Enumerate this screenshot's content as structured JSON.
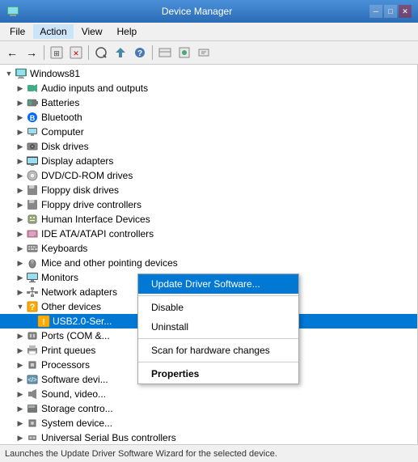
{
  "titlebar": {
    "title": "Device Manager"
  },
  "menu": {
    "items": [
      "File",
      "Action",
      "View",
      "Help"
    ]
  },
  "toolbar": {
    "buttons": [
      "←",
      "→",
      "⊞",
      "⊟",
      "📋",
      "🔄",
      "❌",
      "⚡",
      "🔍"
    ]
  },
  "tree": {
    "root": "Windows81",
    "items": [
      {
        "id": "root",
        "label": "Windows81",
        "level": 1,
        "expand": "expanded",
        "icon": "💻"
      },
      {
        "id": "audio",
        "label": "Audio inputs and outputs",
        "level": 2,
        "expand": "collapsed",
        "icon": "🔊"
      },
      {
        "id": "batteries",
        "label": "Batteries",
        "level": 2,
        "expand": "collapsed",
        "icon": "🔋"
      },
      {
        "id": "bluetooth",
        "label": "Bluetooth",
        "level": 2,
        "expand": "collapsed",
        "icon": "🔵"
      },
      {
        "id": "computer",
        "label": "Computer",
        "level": 2,
        "expand": "collapsed",
        "icon": "💻"
      },
      {
        "id": "diskdrives",
        "label": "Disk drives",
        "level": 2,
        "expand": "collapsed",
        "icon": "💾"
      },
      {
        "id": "display",
        "label": "Display adapters",
        "level": 2,
        "expand": "collapsed",
        "icon": "🖥"
      },
      {
        "id": "dvd",
        "label": "DVD/CD-ROM drives",
        "level": 2,
        "expand": "collapsed",
        "icon": "💿"
      },
      {
        "id": "floppy",
        "label": "Floppy disk drives",
        "level": 2,
        "expand": "collapsed",
        "icon": "💾"
      },
      {
        "id": "floppyctrl",
        "label": "Floppy drive controllers",
        "level": 2,
        "expand": "collapsed",
        "icon": "💾"
      },
      {
        "id": "hid",
        "label": "Human Interface Devices",
        "level": 2,
        "expand": "collapsed",
        "icon": "🎮"
      },
      {
        "id": "ide",
        "label": "IDE ATA/ATAPI controllers",
        "level": 2,
        "expand": "collapsed",
        "icon": "⚙"
      },
      {
        "id": "keyboards",
        "label": "Keyboards",
        "level": 2,
        "expand": "collapsed",
        "icon": "⌨"
      },
      {
        "id": "mice",
        "label": "Mice and other pointing devices",
        "level": 2,
        "expand": "collapsed",
        "icon": "🖱"
      },
      {
        "id": "monitors",
        "label": "Monitors",
        "level": 2,
        "expand": "collapsed",
        "icon": "🖥"
      },
      {
        "id": "network",
        "label": "Network adapters",
        "level": 2,
        "expand": "collapsed",
        "icon": "🌐"
      },
      {
        "id": "other",
        "label": "Other devices",
        "level": 2,
        "expand": "expanded",
        "icon": "❓"
      },
      {
        "id": "usb2",
        "label": "USB2.0-Ser...",
        "level": 3,
        "expand": "none",
        "icon": "⚠",
        "selected": true
      },
      {
        "id": "ports",
        "label": "Ports (COM &...",
        "level": 2,
        "expand": "collapsed",
        "icon": "🔌"
      },
      {
        "id": "printq",
        "label": "Print queues",
        "level": 2,
        "expand": "collapsed",
        "icon": "🖨"
      },
      {
        "id": "proc",
        "label": "Processors",
        "level": 2,
        "expand": "collapsed",
        "icon": "⚙"
      },
      {
        "id": "softdev",
        "label": "Software devi...",
        "level": 2,
        "expand": "collapsed",
        "icon": "📦"
      },
      {
        "id": "sound",
        "label": "Sound, video...",
        "level": 2,
        "expand": "collapsed",
        "icon": "🔊"
      },
      {
        "id": "storage",
        "label": "Storage contro...",
        "level": 2,
        "expand": "collapsed",
        "icon": "💾"
      },
      {
        "id": "system",
        "label": "System device...",
        "level": 2,
        "expand": "collapsed",
        "icon": "⚙"
      },
      {
        "id": "usb",
        "label": "Universal Serial Bus controllers",
        "level": 2,
        "expand": "collapsed",
        "icon": "🔌"
      }
    ]
  },
  "context_menu": {
    "items": [
      {
        "label": "Update Driver Software...",
        "type": "item",
        "active": true
      },
      {
        "type": "sep"
      },
      {
        "label": "Disable",
        "type": "item"
      },
      {
        "label": "Uninstall",
        "type": "item"
      },
      {
        "type": "sep"
      },
      {
        "label": "Scan for hardware changes",
        "type": "item"
      },
      {
        "type": "sep"
      },
      {
        "label": "Properties",
        "type": "item",
        "bold": true
      }
    ]
  },
  "statusbar": {
    "text": "Launches the Update Driver Software Wizard for the selected device."
  }
}
